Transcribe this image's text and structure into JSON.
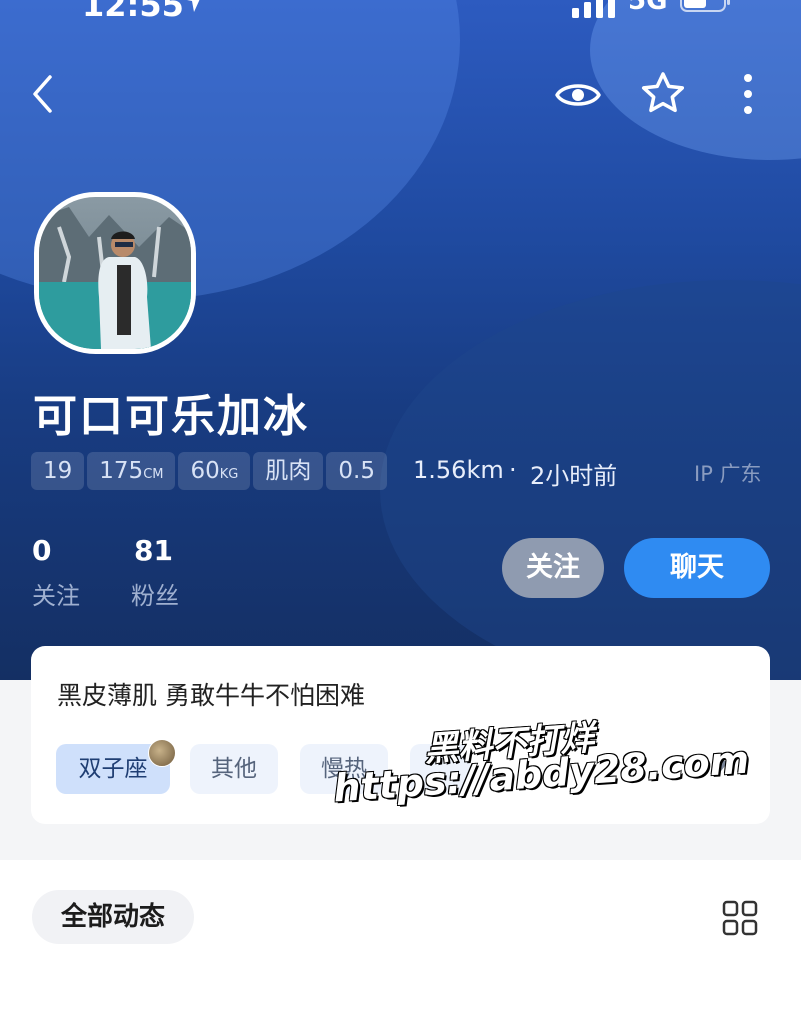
{
  "status_bar": {
    "time": "12:55",
    "network": "5G"
  },
  "profile": {
    "nickname": "可口可乐加冰",
    "stats": [
      {
        "value": "19",
        "unit": ""
      },
      {
        "value": "175",
        "unit": "CM"
      },
      {
        "value": "60",
        "unit": "KG"
      },
      {
        "value": "肌肉",
        "unit": ""
      },
      {
        "value": "0.5",
        "unit": ""
      }
    ],
    "distance": "1.56km",
    "separator": "·",
    "last_active": "2小时前",
    "ip_location": "IP 广东",
    "following_count": "0",
    "following_label": "关注",
    "followers_count": "81",
    "followers_label": "粉丝"
  },
  "actions": {
    "follow_label": "关注",
    "chat_label": "聊天"
  },
  "bio_card": {
    "bio": "黑皮薄肌  勇敢牛牛不怕困难",
    "tags": [
      "双子座",
      "其他",
      "慢热"
    ]
  },
  "watermark": {
    "line1": "黑料不打烊",
    "line2": "https://abdy28.com"
  },
  "feed": {
    "filter_label": "全部动态"
  },
  "colors": {
    "accent": "#2f8bf2",
    "header_dark": "#142f63",
    "header_light": "#2d5bc0"
  }
}
